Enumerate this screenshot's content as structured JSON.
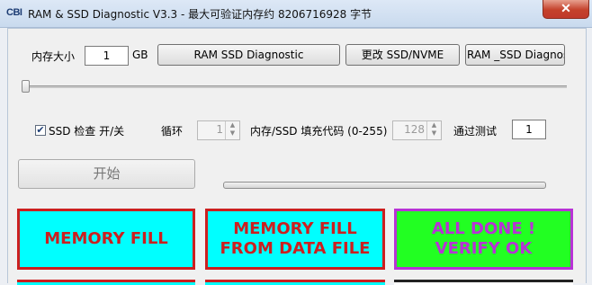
{
  "window": {
    "title": "RAM & SSD Diagnostic V3.3 - 最大可验证内存约 8206716928 字节",
    "icon_text": "CBI",
    "close_glyph": "✕"
  },
  "memory_size": {
    "label": "内存大小",
    "value": "1",
    "unit": "GB"
  },
  "buttons": {
    "ram_ssd": "RAM  SSD Diagnostic",
    "change_ssd": "更改 SSD/NVME",
    "third": "RAM _SSD Diagnostic",
    "start": "开始"
  },
  "slider": {
    "level": 0
  },
  "ssd_check": {
    "label": "SSD 检查 开/关",
    "checked": true,
    "check_glyph": "✔"
  },
  "loop": {
    "label": "循环",
    "value": "1"
  },
  "fill_code": {
    "label": "内存/SSD 填充代码 (0-255)",
    "value": "128"
  },
  "pass_test": {
    "label": "通过测试",
    "value": "1"
  },
  "progress": {
    "level": 0
  },
  "status_boxes": [
    {
      "line1": "MEMORY FILL",
      "line2": "",
      "bg": "#00ffff",
      "border": "#cc1f1f",
      "text_color": "#cc1f1f"
    },
    {
      "line1": "MEMORY FILL",
      "line2": "FROM DATA FILE",
      "bg": "#00ffff",
      "border": "#cc1f1f",
      "text_color": "#cc1f1f"
    },
    {
      "line1": "ALL DONE !",
      "line2": "VERIFY OK",
      "bg": "#22ff22",
      "border": "#b832d6",
      "text_color": "#b832d6"
    }
  ],
  "colors": {
    "accent_red": "#cc1f1f",
    "cyan": "#00ffff",
    "green": "#22ff22",
    "magenta": "#b832d6"
  }
}
